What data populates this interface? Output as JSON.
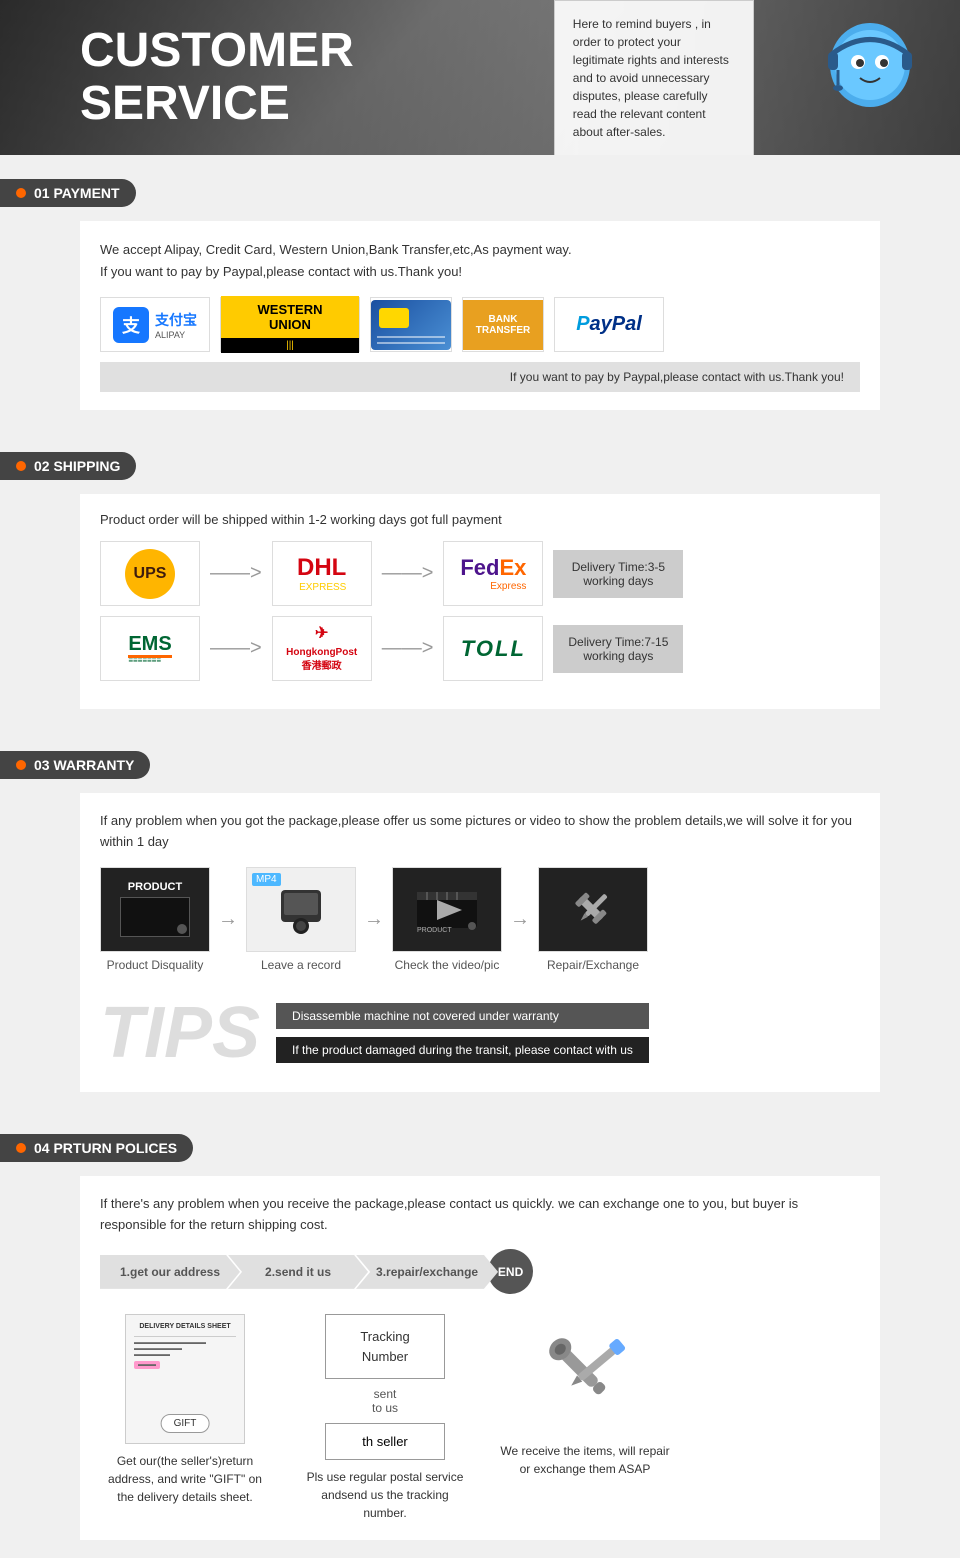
{
  "header": {
    "title": "CUSTOMER\nSERVICE",
    "notice": "Here to remind buyers , in order to protect your legitimate rights and interests and to avoid unnecessary disputes, please carefully read the relevant content about after-sales."
  },
  "payment": {
    "section_number": "01",
    "section_label": "PAYMENT",
    "description_line1": "We accept Alipay, Credit Card, Western Union,Bank Transfer,etc,As payment way.",
    "description_line2": "If you want to pay by Paypal,please contact with us.Thank you!",
    "logos": [
      "Alipay",
      "Western Union",
      "Credit Card",
      "Bank Transfer",
      "PayPal"
    ],
    "paypal_note": "If you want to pay by Paypal,please contact with us.Thank you!"
  },
  "shipping": {
    "section_number": "02",
    "section_label": "SHIPPING",
    "description": "Product order will be shipped within 1-2 working days got full payment",
    "carriers_row1": [
      "UPS",
      "DHL Express",
      "FedEx Express"
    ],
    "delivery_time_row1": "Delivery Time:3-5\nworking days",
    "carriers_row2": [
      "EMS",
      "HongKong Post",
      "TOLL"
    ],
    "delivery_time_row2": "Delivery Time:7-15\nworking days"
  },
  "warranty": {
    "section_number": "03",
    "section_label": "WARRANTY",
    "description": "If any problem when you got the package,please offer us some pictures or video to show the problem details,we will solve it for you within 1 day",
    "flow": [
      {
        "label": "PRODUCT",
        "type": "dark"
      },
      {
        "label": "Leave a record",
        "type": "mp4"
      },
      {
        "label": "Check the video/pic",
        "type": "video"
      },
      {
        "label": "Repair/Exchange",
        "type": "tools"
      }
    ],
    "flow_labels": [
      "Product Disquality",
      "Leave a record",
      "Check the video/pic",
      "Repair/Exchange"
    ],
    "tips_title": "TIPS",
    "tips_items": [
      "Disassemble machine not covered under warranty",
      "If the product damaged during the transit, please contact with us"
    ]
  },
  "return": {
    "section_number": "04",
    "section_label": "PRTURN POLICES",
    "description_line1": "If  there's any problem when you receive the package,please contact us quickly. we can exchange one to you, but buyer is",
    "description_line2": "responsible for the return shipping cost.",
    "steps": [
      "1.get our address",
      "2.send it us",
      "3.repair/exchange",
      "END"
    ],
    "process_items": [
      {
        "title": "Delivery Sheet",
        "desc": "Get our(the seller's)return address, and write \"GIFT\" on the delivery details sheet."
      },
      {
        "title": "Tracking Number",
        "desc": "Pls use regular postal service andsend us the tracking number."
      },
      {
        "title": "Repair",
        "desc": "We receive the items, will repair or exchange them ASAP"
      }
    ],
    "tracking_label": "Tracking\nNumber",
    "sent_to_us": "sent\nto us",
    "th_seller": "th seller"
  }
}
